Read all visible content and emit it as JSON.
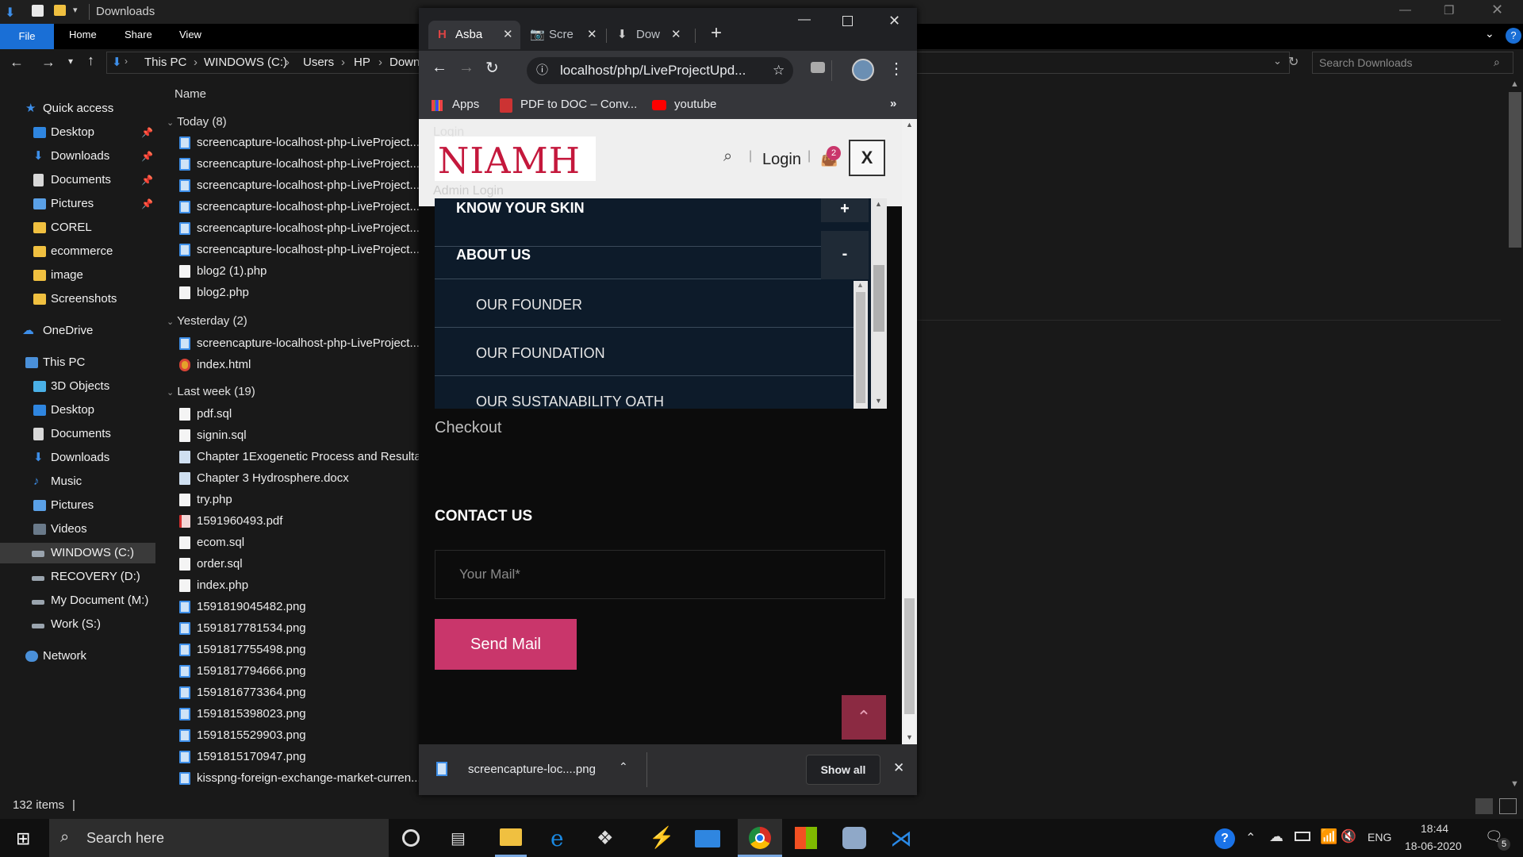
{
  "explorer": {
    "title": "Downloads",
    "ribbon_tabs": [
      "File",
      "Home",
      "Share",
      "View"
    ],
    "breadcrumb": [
      "This PC",
      "WINDOWS (C:)",
      "Users",
      "HP",
      "Down"
    ],
    "search_placeholder": "Search Downloads",
    "column_name": "Name",
    "nav": {
      "quick_access": "Quick access",
      "quick_items": [
        "Desktop",
        "Downloads",
        "Documents",
        "Pictures",
        "COREL",
        "ecommerce",
        "image",
        "Screenshots"
      ],
      "onedrive": "OneDrive",
      "this_pc": "This PC",
      "pc_items": [
        "3D Objects",
        "Desktop",
        "Documents",
        "Downloads",
        "Music",
        "Pictures",
        "Videos",
        "WINDOWS (C:)",
        "RECOVERY (D:)",
        "My Document (M:)",
        "Work (S:)"
      ],
      "network": "Network"
    },
    "groups": {
      "today": "Today (8)",
      "yesterday": "Yesterday (2)",
      "last_week": "Last week (19)"
    },
    "files_today": [
      "screencapture-localhost-php-LiveProject...",
      "screencapture-localhost-php-LiveProject...",
      "screencapture-localhost-php-LiveProject...",
      "screencapture-localhost-php-LiveProject...",
      "screencapture-localhost-php-LiveProject...",
      "screencapture-localhost-php-LiveProject...",
      "blog2 (1).php",
      "blog2.php"
    ],
    "files_yesterday": [
      "screencapture-localhost-php-LiveProject...",
      "index.html"
    ],
    "files_last_week": [
      "pdf.sql",
      "signin.sql",
      "Chapter 1Exogenetic Process and Resulta...",
      "Chapter 3 Hydrosphere.docx",
      "try.php",
      "1591960493.pdf",
      "ecom.sql",
      "order.sql",
      "index.php",
      "1591819045482.png",
      "1591817781534.png",
      "1591817755498.png",
      "1591817794666.png",
      "1591816773364.png",
      "1591815398023.png",
      "1591815529903.png",
      "1591815170947.png",
      "kisspng-foreign-exchange-market-curren..."
    ],
    "status": "132 items"
  },
  "browser": {
    "tabs": [
      "Asba",
      "Scre",
      "Dow"
    ],
    "url": "localhost/php/LiveProjectUpd...",
    "bookmarks": [
      "Apps",
      "PDF to DOC – Conv...",
      "youtube"
    ],
    "download_file": "screencapture-loc....png",
    "show_all": "Show all"
  },
  "site": {
    "logo": "NIAMH",
    "login": "Login",
    "cart_count": "2",
    "close": "X",
    "ghost_top": "Login",
    "ghost_mid": "Admin Login",
    "menu": {
      "know_your_skin": "KNOW YOUR SKIN",
      "plus": "+",
      "about_us": "ABOUT US",
      "minus": "-",
      "sub": [
        "OUR FOUNDER",
        "OUR FOUNDATION",
        "OUR SUSTANABILITY OATH"
      ]
    },
    "checkout": "Checkout",
    "contact_heading": "CONTACT US",
    "mail_placeholder": "Your Mail*",
    "send_button": "Send Mail"
  },
  "taskbar": {
    "search": "Search here",
    "lang": "ENG",
    "time": "18:44",
    "date": "18-06-2020",
    "notif_count": "5"
  },
  "colors": {
    "explorer_bg": "#191919",
    "file_tab": "#1a6fd6",
    "logo_red": "#c4183c",
    "menu_bg": "#0d1b2a",
    "send_button": "#c9366b",
    "scroll_top": "#8b2a42",
    "taskbar": "#101010"
  }
}
